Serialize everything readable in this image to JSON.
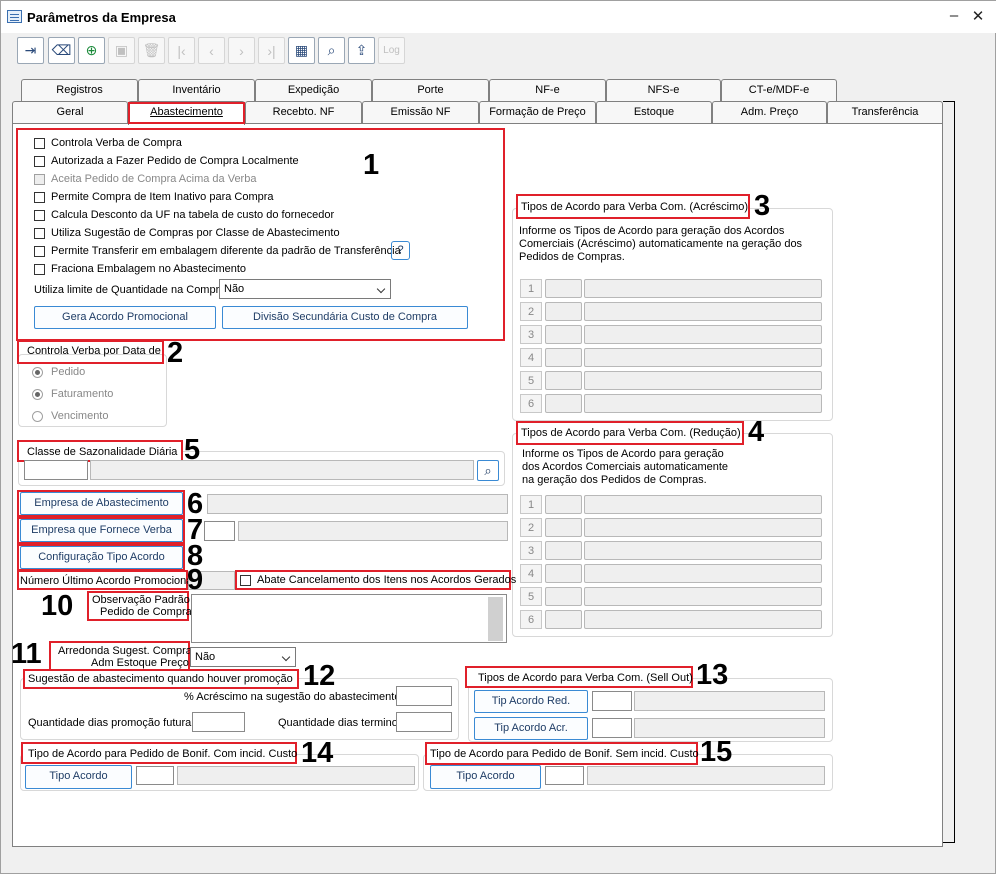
{
  "window": {
    "title": "Parâmetros da Empresa",
    "minimize": "–",
    "close": "✕"
  },
  "toolbar": {
    "items": [
      "exit-icon",
      "eraser-icon",
      "add-icon",
      "save-icon",
      "delete-icon",
      "first-icon",
      "prev-icon",
      "next-icon",
      "last-icon",
      "grid-icon",
      "search-icon",
      "export-icon"
    ],
    "log_label": "Log"
  },
  "tabs": {
    "row1": [
      "Registros",
      "Inventário",
      "Expedição",
      "Porte",
      "NF-e",
      "NFS-e",
      "CT-e/MDF-e"
    ],
    "row2": [
      "Geral",
      "Abastecimento",
      "Recebto. NF",
      "Emissão NF",
      "Formação de Preço",
      "Estoque",
      "Adm. Preço",
      "Transferência"
    ],
    "active": "Abastecimento"
  },
  "annotations": [
    "1",
    "2",
    "3",
    "4",
    "5",
    "6",
    "7",
    "8",
    "9",
    "10",
    "11",
    "12",
    "13",
    "14",
    "15"
  ],
  "section1": {
    "checkboxes": [
      {
        "label": "Controla Verba de Compra",
        "disabled": false
      },
      {
        "label": "Autorizada a Fazer Pedido de Compra Localmente",
        "disabled": false
      },
      {
        "label": "Aceita Pedido de Compra Acima da Verba",
        "disabled": true
      },
      {
        "label": "Permite Compra de Item Inativo para Compra",
        "disabled": false
      },
      {
        "label": "Calcula Desconto da UF na tabela de custo do fornecedor",
        "disabled": false
      },
      {
        "label": "Utiliza Sugestão de Compras por Classe de Abastecimento",
        "disabled": false
      },
      {
        "label": "Permite Transferir em embalagem diferente da padrão de Transferência",
        "disabled": false
      },
      {
        "label": "Fraciona Embalagem no Abastecimento",
        "disabled": false
      }
    ],
    "limite_label": "Utiliza limite de Quantidade na Compra",
    "limite_value": "Não",
    "btn_acordo": "Gera Acordo Promocional",
    "btn_divisao": "Divisão Secundária Custo de Compra"
  },
  "section2": {
    "title": "Controla Verba por Data de",
    "options": [
      "Pedido",
      "Faturamento",
      "Vencimento"
    ],
    "selected": 0
  },
  "section3": {
    "title": "Tipos de Acordo para Verba Com. (Acréscimo)",
    "desc": [
      "Informe os Tipos de Acordo para geração dos Acordos",
      "Comerciais (Acréscimo) automaticamente na geração dos",
      "Pedidos de Compras."
    ],
    "rows": [
      "1",
      "2",
      "3",
      "4",
      "5",
      "6"
    ]
  },
  "section4": {
    "title": "Tipos de Acordo para Verba Com. (Redução)",
    "desc": [
      "Informe os Tipos de Acordo para geração",
      "dos Acordos Comerciais automaticamente",
      "na geração dos Pedidos de Compras."
    ],
    "rows": [
      "1",
      "2",
      "3",
      "4",
      "5",
      "6"
    ]
  },
  "section5": {
    "title": "Classe de Sazonalidade Diária"
  },
  "buttons": {
    "empresa_abast": "Empresa de Abastecimento",
    "empresa_verba": "Empresa que Fornece Verba",
    "config_acordo": "Configuração Tipo Acordo"
  },
  "section9": {
    "label": "Número Último Acordo Promocional",
    "abate": "Abate Cancelamento dos Itens nos Acordos Gerados"
  },
  "section10": {
    "line1": "Observação Padrão",
    "line2": "Pedido de Compra"
  },
  "section11": {
    "line1": "Arredonda Sugest. Compra",
    "line2": "Adm Estoque Preço",
    "value": "Não"
  },
  "section12": {
    "title": "Sugestão de abastecimento quando houver promoção",
    "acrescimo": "% Acréscimo na sugestão do abastecimento",
    "dias_futura": "Quantidade dias promoção futura",
    "dias_termino": "Quantidade dias termino"
  },
  "section13": {
    "title": "Tipos de Acordo para Verba Com. (Sell Out)",
    "btn_red": "Tip Acordo Red.",
    "btn_acr": "Tip Acordo Acr."
  },
  "section14": {
    "title": "Tipo de Acordo para Pedido de Bonif. Com incid. Custo",
    "btn": "Tipo Acordo"
  },
  "section15": {
    "title": "Tipo de Acordo para Pedido de Bonif. Sem incid. Custo",
    "btn": "Tipo Acordo"
  },
  "colors": {
    "accent": "#3a8ad4",
    "annotation": "#e0202a"
  }
}
